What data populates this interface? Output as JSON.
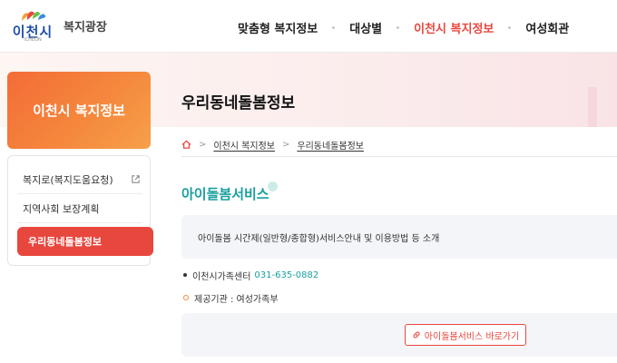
{
  "header": {
    "logo_text": "이천시",
    "logo_sub": "ICHEON",
    "site_name": "복지광장",
    "nav": [
      {
        "label": "맞춤형 복지정보",
        "active": false
      },
      {
        "label": "대상별",
        "active": false
      },
      {
        "label": "이천시 복지정보",
        "active": true
      },
      {
        "label": "여성회관",
        "active": false
      }
    ]
  },
  "sidebar": {
    "title": "이천시 복지정보",
    "items": [
      {
        "label": "복지로(복지도움요청)",
        "external": true
      },
      {
        "label": "지역사회 보장계획",
        "external": false
      },
      {
        "label": "우리동네돌봄정보",
        "active": true
      }
    ]
  },
  "main": {
    "page_title": "우리동네돌봄정보",
    "breadcrumb": [
      "이천시 복지정보",
      "우리동네돌봄정보"
    ],
    "section_title": "아이돌봄서비스",
    "description": "아이돌봄 시간제(일반형/종합형)서비스안내 및 이용방법 등 소개",
    "contact_label": "이천시가족센터",
    "contact_phone": "031-635-0882",
    "provider": "제공기관 : 여성가족부",
    "link_button": "아이돌봄서비스 바로가기"
  },
  "colors": {
    "accent_red": "#e8473e",
    "accent_orange": "#f5873c",
    "teal": "#1a9f9f"
  }
}
